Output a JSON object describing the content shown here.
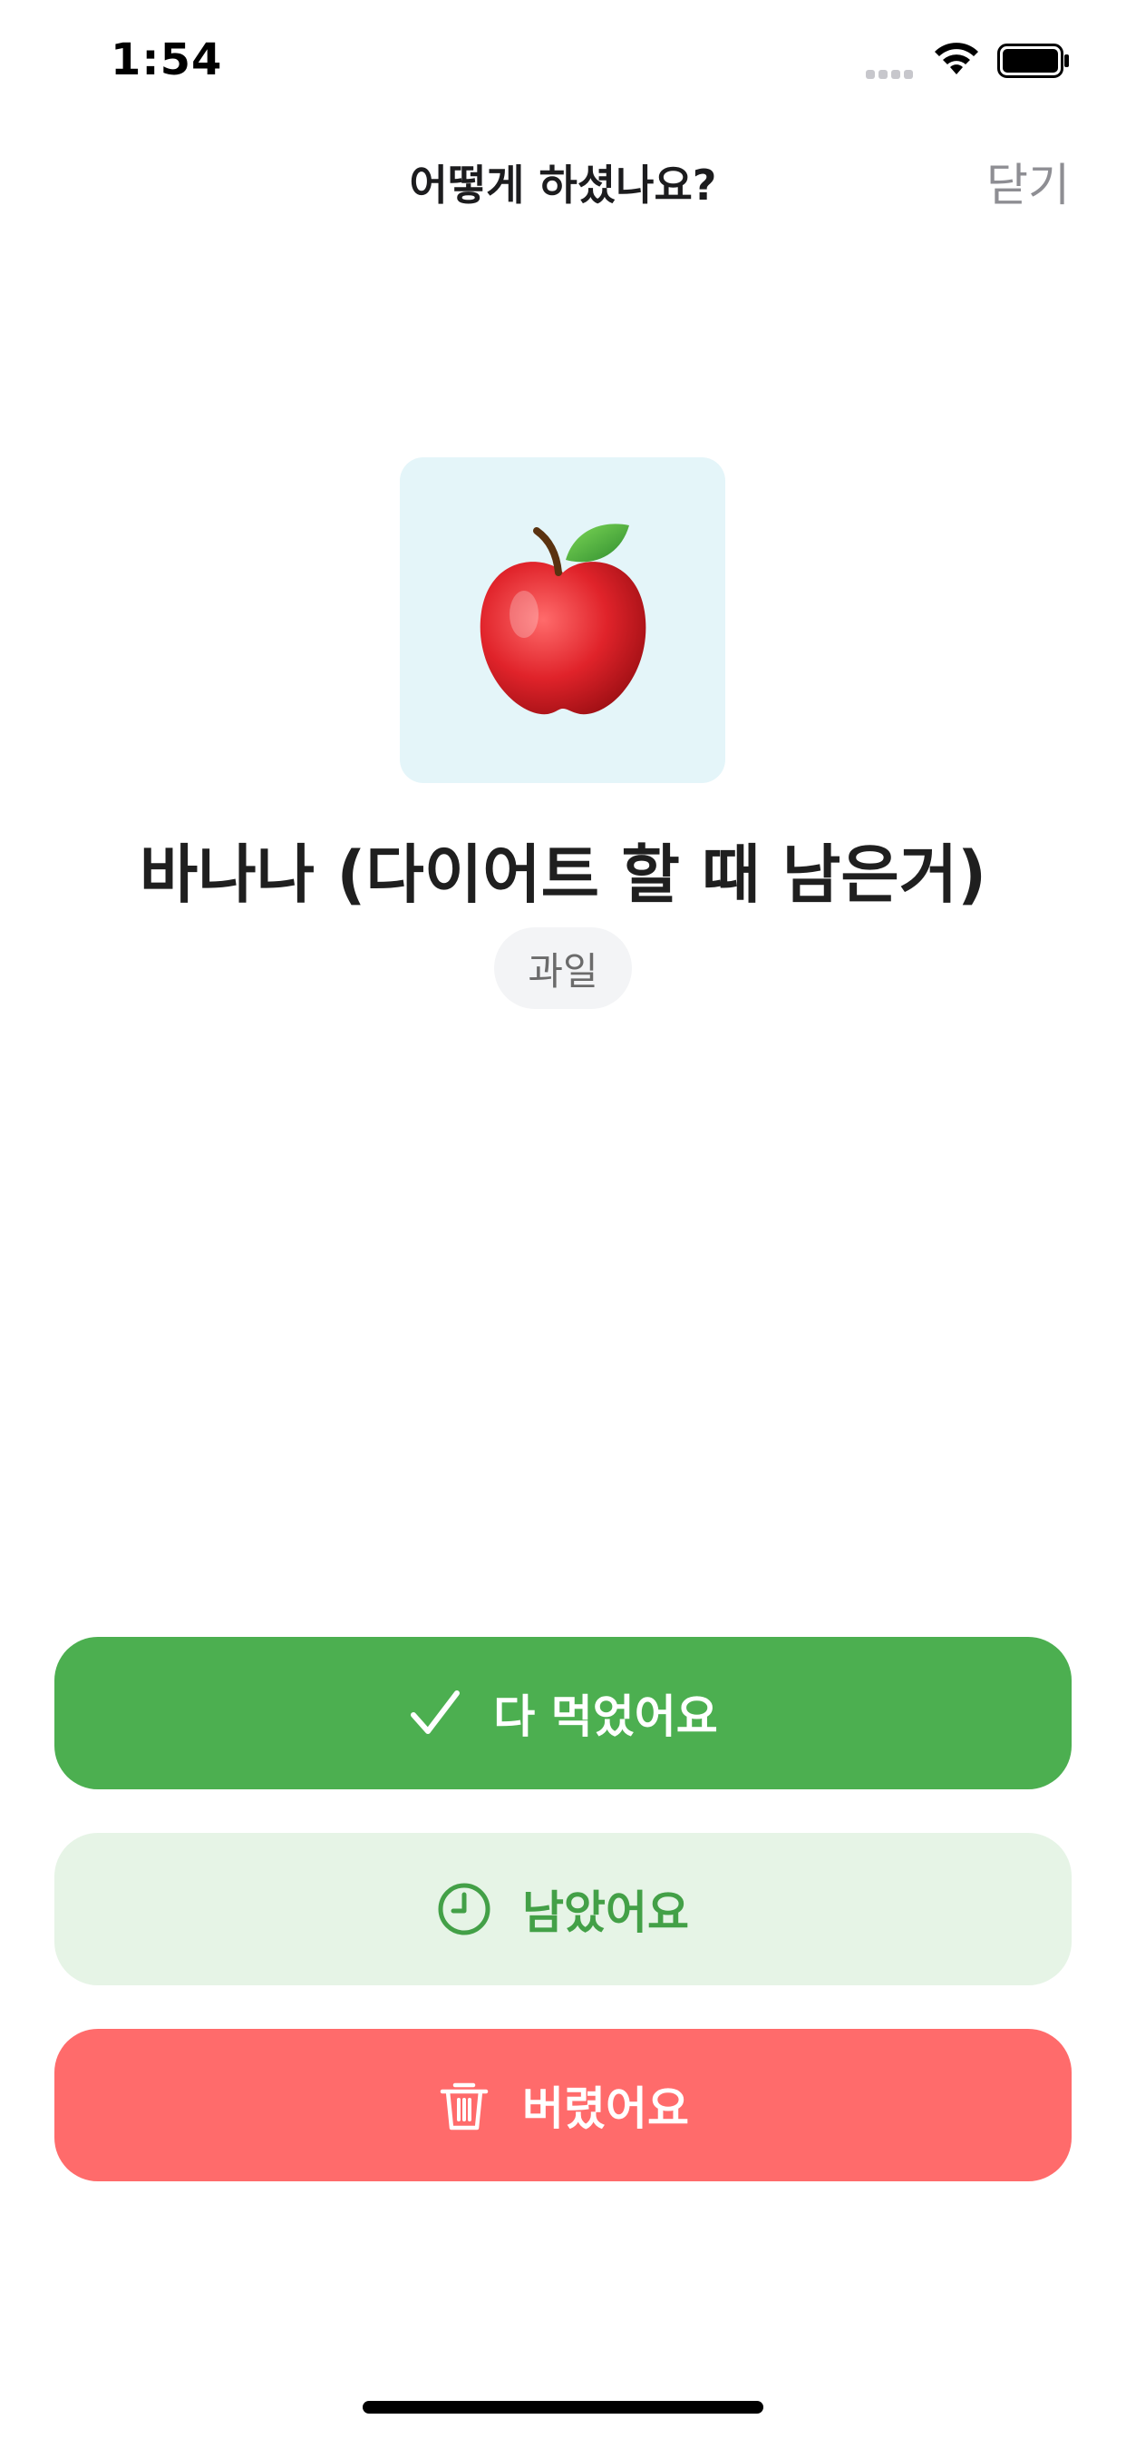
{
  "status_bar": {
    "time": "1:54"
  },
  "header": {
    "title": "어떻게 하셨나요?",
    "close_label": "닫기"
  },
  "item": {
    "name": "바나나 (다이어트 할 때 남은거)",
    "category": "과일",
    "icon": "apple-emoji"
  },
  "actions": [
    {
      "label": "다 먹었어요",
      "icon": "checkmark-icon"
    },
    {
      "label": "남았어요",
      "icon": "clock-icon"
    },
    {
      "label": "버렸어요",
      "icon": "trash-icon"
    }
  ],
  "colors": {
    "eaten": "#4caf50",
    "left_bg": "#e6f4e6",
    "left_text": "#43a047",
    "thrown": "#ff6b6b",
    "image_bg": "#e4f5f9"
  }
}
